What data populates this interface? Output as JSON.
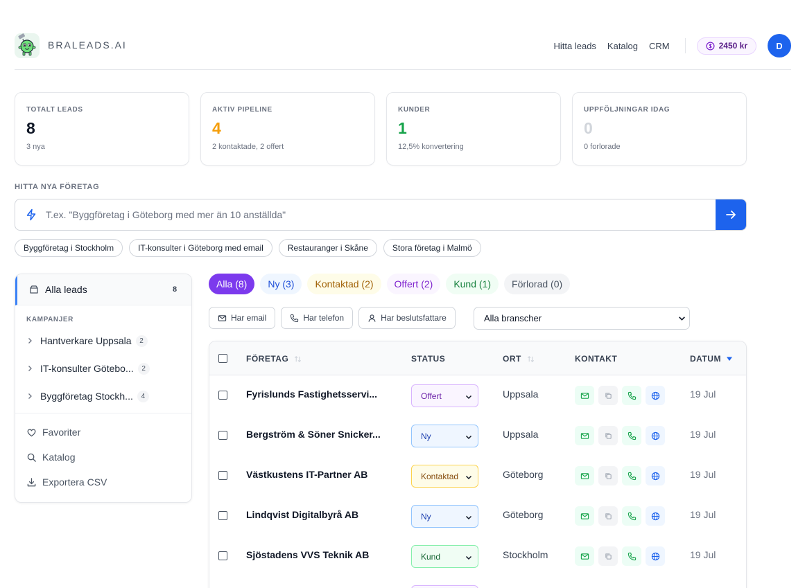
{
  "header": {
    "brand": "BRALEADS.AI",
    "nav": [
      "Hitta leads",
      "Katalog",
      "CRM"
    ],
    "credits": "2450 kr",
    "avatar_initial": "D"
  },
  "stats": [
    {
      "label": "TOTALT LEADS",
      "value": "8",
      "sub": "3 nya",
      "color": "#111827"
    },
    {
      "label": "AKTIV PIPELINE",
      "value": "4",
      "sub": "2 kontaktade, 2 offert",
      "color": "#f59e0b"
    },
    {
      "label": "KUNDER",
      "value": "1",
      "sub": "12,5% konvertering",
      "color": "#16a34a"
    },
    {
      "label": "UPPFÖLJNINGAR IDAG",
      "value": "0",
      "sub": "0 forlorade",
      "color": "#d1d5db"
    }
  ],
  "search": {
    "title": "HITTA NYA FÖRETAG",
    "placeholder": "T.ex. \"Byggföretag i Göteborg med mer än 10 anställda\"",
    "value": "",
    "suggestions": [
      "Byggföretag i Stockholm",
      "IT-konsulter i Göteborg med email",
      "Restauranger i Skåne",
      "Stora företag i Malmö"
    ]
  },
  "sidebar": {
    "all_leads": {
      "label": "Alla leads",
      "count": "8"
    },
    "campaigns_title": "KAMPANJER",
    "campaigns": [
      {
        "label": "Hantverkare Uppsala",
        "count": "2"
      },
      {
        "label": "IT-konsulter Götebo...",
        "count": "2"
      },
      {
        "label": "Byggföretag Stockh...",
        "count": "4"
      }
    ],
    "links": [
      "Favoriter",
      "Katalog",
      "Exportera CSV"
    ]
  },
  "tabs": [
    {
      "label": "Alla (8)",
      "bg": "#7c3aed",
      "fg": "#ffffff"
    },
    {
      "label": "Ny (3)",
      "bg": "#eff6ff",
      "fg": "#1d4ed8"
    },
    {
      "label": "Kontaktad (2)",
      "bg": "#fefce8",
      "fg": "#a16207"
    },
    {
      "label": "Offert (2)",
      "bg": "#faf5ff",
      "fg": "#7e22ce"
    },
    {
      "label": "Kund (1)",
      "bg": "#f0fdf4",
      "fg": "#15803d"
    },
    {
      "label": "Förlorad (0)",
      "bg": "#f3f4f6",
      "fg": "#4b5563"
    }
  ],
  "filters": {
    "has_email": "Har email",
    "has_phone": "Har telefon",
    "has_decision_maker": "Har beslutsfattare",
    "industry_selected": "Alla branscher"
  },
  "table": {
    "headers": {
      "company": "FÖRETAG",
      "status": "STATUS",
      "city": "ORT",
      "contact": "KONTAKT",
      "date": "DATUM"
    },
    "rows": [
      {
        "company": "Fyrislunds Fastighetsservi...",
        "status": "Offert",
        "city": "Uppsala",
        "date": "19 Jul"
      },
      {
        "company": "Bergström & Söner Snicker...",
        "status": "Ny",
        "city": "Uppsala",
        "date": "19 Jul"
      },
      {
        "company": "Västkustens IT-Partner AB",
        "status": "Kontaktad",
        "city": "Göteborg",
        "date": "19 Jul"
      },
      {
        "company": "Lindqvist Digitalbyrå AB",
        "status": "Ny",
        "city": "Göteborg",
        "date": "19 Jul"
      },
      {
        "company": "Sjöstadens VVS Teknik AB",
        "status": "Kund",
        "city": "Stockholm",
        "date": "19 Jul"
      }
    ]
  },
  "status_colors": {
    "Offert": {
      "bg": "#faf5ff",
      "border": "#d8b4fe",
      "fg": "#6b21a8"
    },
    "Ny": {
      "bg": "#eff6ff",
      "border": "#93c5fd",
      "fg": "#1e40af"
    },
    "Kontaktad": {
      "bg": "#fefce8",
      "border": "#fcd34d",
      "fg": "#854d0e"
    },
    "Kund": {
      "bg": "#f0fdf4",
      "border": "#86efac",
      "fg": "#166534"
    }
  }
}
